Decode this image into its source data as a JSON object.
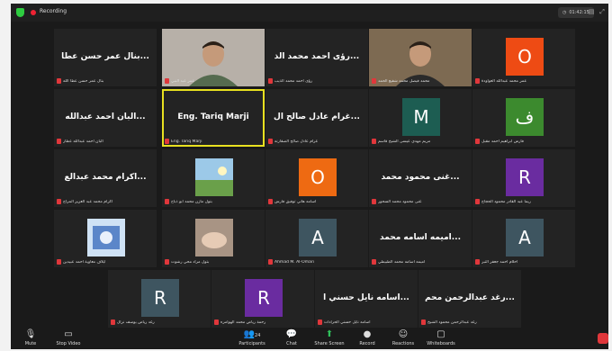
{
  "topbar": {
    "recording": "Recording",
    "time": "01:42:15"
  },
  "tiles": [
    {
      "name": "...بنال عمر حسن عطا",
      "caption": "بنال عمر حسن عطا الله",
      "type": "name"
    },
    {
      "name": "",
      "caption": "عمر عبد النبي",
      "type": "video"
    },
    {
      "name": "...رؤى احمد محمد الذ",
      "caption": "رؤى احمد محمد الذيب",
      "type": "name"
    },
    {
      "name": "",
      "caption": "محمد فيصل محمد شفيع الحمد",
      "type": "video2"
    },
    {
      "name": "O",
      "caption": "عمر محمد عبدالله العواودة",
      "type": "avatar",
      "color": "#ee4b14"
    },
    {
      "name": "...البان احمد عبدالله",
      "caption": "البان احمد عبدالله عطار",
      "type": "name"
    },
    {
      "name": "Eng. Tariq Marji",
      "caption": "Eng. Tariq Marji",
      "type": "name",
      "active": true
    },
    {
      "name": "...غرام عادل صالح ال",
      "caption": "غرام عادل صالح الصقارنه",
      "type": "name"
    },
    {
      "name": "M",
      "caption": "مريم مهدي عيسى الشيخ قاسم",
      "type": "avatar",
      "color": "#1d5d52"
    },
    {
      "name": "ف",
      "caption": "فارس ابراهيم احمد مقبل",
      "type": "avatar",
      "color": "#3c8a2e"
    },
    {
      "name": "...اكرام محمد عبدالع",
      "caption": "اكرام محمد عبد العزيز المراج",
      "type": "name"
    },
    {
      "name": "",
      "caption": "بتول مازن محمد ابو ذباح",
      "type": "landscape"
    },
    {
      "name": "O",
      "caption": "اسامه هاني توفيق فارس",
      "type": "avatar",
      "color": "#ee6a12"
    },
    {
      "name": "...غنى محمود محمد",
      "caption": "غنى محمود محمد السحور",
      "type": "name"
    },
    {
      "name": "R",
      "caption": "ريما عبد القادر محمود الحجاج",
      "type": "avatar",
      "color": "#6a2ca0"
    },
    {
      "name": "",
      "caption": "ايلاف معاوية احمد عبيدين",
      "type": "blue"
    },
    {
      "name": "",
      "caption": "بتول مراد محي رشوت",
      "type": "hands"
    },
    {
      "name": "A",
      "caption": "Ahmad M. Al-Omari",
      "type": "avatar",
      "color": "#3e5560"
    },
    {
      "name": "...اميمه اسامه محمد",
      "caption": "اميمه اسامه محمد الطبيطي",
      "type": "name"
    },
    {
      "name": "A",
      "caption": "احلام احمد جعفر التبر",
      "type": "avatar",
      "color": "#3e5560"
    },
    {
      "name": "R",
      "caption": "رغد رياض يوسف نزال",
      "type": "avatar",
      "color": "#3e5560"
    },
    {
      "name": "R",
      "caption": "رحمة رياض محمد الهوامره",
      "type": "avatar",
      "color": "#6a2ca0"
    },
    {
      "name": "...اسامه نايل حسني ا",
      "caption": "اسامه نايل حسني الحرادات",
      "type": "name"
    },
    {
      "name": "...رغد عبدالرحمن محم",
      "caption": "رغد عبدالرحمن محمود الشيخ",
      "type": "name"
    }
  ],
  "toolbar": {
    "mute": "Mute",
    "stop_video": "Stop Video",
    "participants": "Participants",
    "participants_count": "24",
    "chat": "Chat",
    "share": "Share Screen",
    "record": "Record",
    "reactions": "Reactions",
    "whiteboards": "Whiteboards"
  }
}
